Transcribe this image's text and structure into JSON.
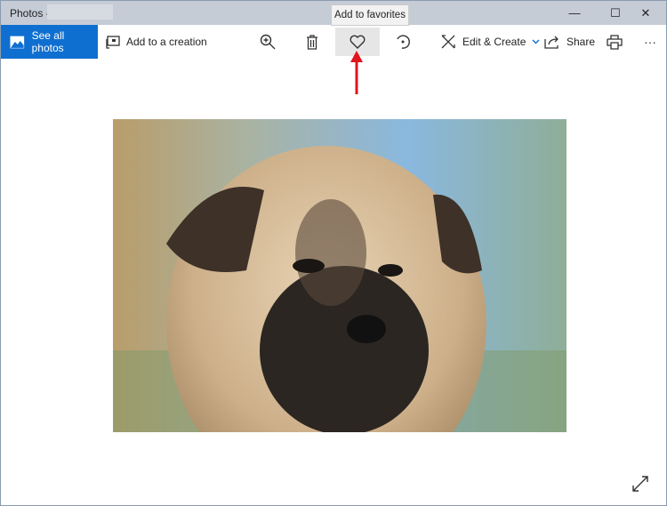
{
  "window": {
    "title": "Photos -",
    "minimize": "—",
    "maximize": "☐",
    "close": "✕"
  },
  "toolbar": {
    "see_all_photos": "See all photos",
    "add_to_creation": "Add to a creation",
    "edit_create": "Edit & Create",
    "share": "Share",
    "more": "···"
  },
  "tooltip": {
    "text": "Add to favorites"
  },
  "colors": {
    "accent": "#0f6fd0",
    "arrow": "#e0141c"
  }
}
